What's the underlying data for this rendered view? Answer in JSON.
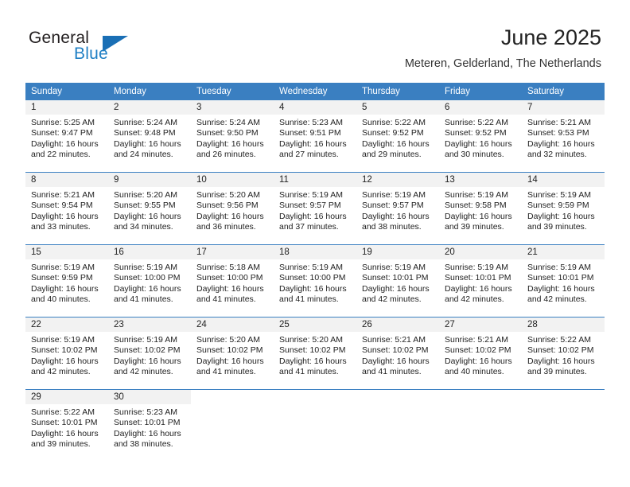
{
  "brand": {
    "name_top": "General",
    "name_bottom": "Blue",
    "accent_color": "#1a6fb5",
    "flag_icon": "flag-triangle-icon"
  },
  "header": {
    "title": "June 2025",
    "subtitle": "Meteren, Gelderland, The Netherlands"
  },
  "theme": {
    "header_bg": "#3a7fc1",
    "daynum_bg": "#f2f2f2",
    "cell_bg": "#ffffff",
    "text": "#222222"
  },
  "calendar": {
    "weekday_headers": [
      "Sunday",
      "Monday",
      "Tuesday",
      "Wednesday",
      "Thursday",
      "Friday",
      "Saturday"
    ],
    "weeks": [
      [
        {
          "day": "1",
          "sunrise": "Sunrise: 5:25 AM",
          "sunset": "Sunset: 9:47 PM",
          "daylight_1": "Daylight: 16 hours",
          "daylight_2": "and 22 minutes."
        },
        {
          "day": "2",
          "sunrise": "Sunrise: 5:24 AM",
          "sunset": "Sunset: 9:48 PM",
          "daylight_1": "Daylight: 16 hours",
          "daylight_2": "and 24 minutes."
        },
        {
          "day": "3",
          "sunrise": "Sunrise: 5:24 AM",
          "sunset": "Sunset: 9:50 PM",
          "daylight_1": "Daylight: 16 hours",
          "daylight_2": "and 26 minutes."
        },
        {
          "day": "4",
          "sunrise": "Sunrise: 5:23 AM",
          "sunset": "Sunset: 9:51 PM",
          "daylight_1": "Daylight: 16 hours",
          "daylight_2": "and 27 minutes."
        },
        {
          "day": "5",
          "sunrise": "Sunrise: 5:22 AM",
          "sunset": "Sunset: 9:52 PM",
          "daylight_1": "Daylight: 16 hours",
          "daylight_2": "and 29 minutes."
        },
        {
          "day": "6",
          "sunrise": "Sunrise: 5:22 AM",
          "sunset": "Sunset: 9:52 PM",
          "daylight_1": "Daylight: 16 hours",
          "daylight_2": "and 30 minutes."
        },
        {
          "day": "7",
          "sunrise": "Sunrise: 5:21 AM",
          "sunset": "Sunset: 9:53 PM",
          "daylight_1": "Daylight: 16 hours",
          "daylight_2": "and 32 minutes."
        }
      ],
      [
        {
          "day": "8",
          "sunrise": "Sunrise: 5:21 AM",
          "sunset": "Sunset: 9:54 PM",
          "daylight_1": "Daylight: 16 hours",
          "daylight_2": "and 33 minutes."
        },
        {
          "day": "9",
          "sunrise": "Sunrise: 5:20 AM",
          "sunset": "Sunset: 9:55 PM",
          "daylight_1": "Daylight: 16 hours",
          "daylight_2": "and 34 minutes."
        },
        {
          "day": "10",
          "sunrise": "Sunrise: 5:20 AM",
          "sunset": "Sunset: 9:56 PM",
          "daylight_1": "Daylight: 16 hours",
          "daylight_2": "and 36 minutes."
        },
        {
          "day": "11",
          "sunrise": "Sunrise: 5:19 AM",
          "sunset": "Sunset: 9:57 PM",
          "daylight_1": "Daylight: 16 hours",
          "daylight_2": "and 37 minutes."
        },
        {
          "day": "12",
          "sunrise": "Sunrise: 5:19 AM",
          "sunset": "Sunset: 9:57 PM",
          "daylight_1": "Daylight: 16 hours",
          "daylight_2": "and 38 minutes."
        },
        {
          "day": "13",
          "sunrise": "Sunrise: 5:19 AM",
          "sunset": "Sunset: 9:58 PM",
          "daylight_1": "Daylight: 16 hours",
          "daylight_2": "and 39 minutes."
        },
        {
          "day": "14",
          "sunrise": "Sunrise: 5:19 AM",
          "sunset": "Sunset: 9:59 PM",
          "daylight_1": "Daylight: 16 hours",
          "daylight_2": "and 39 minutes."
        }
      ],
      [
        {
          "day": "15",
          "sunrise": "Sunrise: 5:19 AM",
          "sunset": "Sunset: 9:59 PM",
          "daylight_1": "Daylight: 16 hours",
          "daylight_2": "and 40 minutes."
        },
        {
          "day": "16",
          "sunrise": "Sunrise: 5:19 AM",
          "sunset": "Sunset: 10:00 PM",
          "daylight_1": "Daylight: 16 hours",
          "daylight_2": "and 41 minutes."
        },
        {
          "day": "17",
          "sunrise": "Sunrise: 5:18 AM",
          "sunset": "Sunset: 10:00 PM",
          "daylight_1": "Daylight: 16 hours",
          "daylight_2": "and 41 minutes."
        },
        {
          "day": "18",
          "sunrise": "Sunrise: 5:19 AM",
          "sunset": "Sunset: 10:00 PM",
          "daylight_1": "Daylight: 16 hours",
          "daylight_2": "and 41 minutes."
        },
        {
          "day": "19",
          "sunrise": "Sunrise: 5:19 AM",
          "sunset": "Sunset: 10:01 PM",
          "daylight_1": "Daylight: 16 hours",
          "daylight_2": "and 42 minutes."
        },
        {
          "day": "20",
          "sunrise": "Sunrise: 5:19 AM",
          "sunset": "Sunset: 10:01 PM",
          "daylight_1": "Daylight: 16 hours",
          "daylight_2": "and 42 minutes."
        },
        {
          "day": "21",
          "sunrise": "Sunrise: 5:19 AM",
          "sunset": "Sunset: 10:01 PM",
          "daylight_1": "Daylight: 16 hours",
          "daylight_2": "and 42 minutes."
        }
      ],
      [
        {
          "day": "22",
          "sunrise": "Sunrise: 5:19 AM",
          "sunset": "Sunset: 10:02 PM",
          "daylight_1": "Daylight: 16 hours",
          "daylight_2": "and 42 minutes."
        },
        {
          "day": "23",
          "sunrise": "Sunrise: 5:19 AM",
          "sunset": "Sunset: 10:02 PM",
          "daylight_1": "Daylight: 16 hours",
          "daylight_2": "and 42 minutes."
        },
        {
          "day": "24",
          "sunrise": "Sunrise: 5:20 AM",
          "sunset": "Sunset: 10:02 PM",
          "daylight_1": "Daylight: 16 hours",
          "daylight_2": "and 41 minutes."
        },
        {
          "day": "25",
          "sunrise": "Sunrise: 5:20 AM",
          "sunset": "Sunset: 10:02 PM",
          "daylight_1": "Daylight: 16 hours",
          "daylight_2": "and 41 minutes."
        },
        {
          "day": "26",
          "sunrise": "Sunrise: 5:21 AM",
          "sunset": "Sunset: 10:02 PM",
          "daylight_1": "Daylight: 16 hours",
          "daylight_2": "and 41 minutes."
        },
        {
          "day": "27",
          "sunrise": "Sunrise: 5:21 AM",
          "sunset": "Sunset: 10:02 PM",
          "daylight_1": "Daylight: 16 hours",
          "daylight_2": "and 40 minutes."
        },
        {
          "day": "28",
          "sunrise": "Sunrise: 5:22 AM",
          "sunset": "Sunset: 10:02 PM",
          "daylight_1": "Daylight: 16 hours",
          "daylight_2": "and 39 minutes."
        }
      ],
      [
        {
          "day": "29",
          "sunrise": "Sunrise: 5:22 AM",
          "sunset": "Sunset: 10:01 PM",
          "daylight_1": "Daylight: 16 hours",
          "daylight_2": "and 39 minutes."
        },
        {
          "day": "30",
          "sunrise": "Sunrise: 5:23 AM",
          "sunset": "Sunset: 10:01 PM",
          "daylight_1": "Daylight: 16 hours",
          "daylight_2": "and 38 minutes."
        },
        {
          "day": "",
          "sunrise": "",
          "sunset": "",
          "daylight_1": "",
          "daylight_2": ""
        },
        {
          "day": "",
          "sunrise": "",
          "sunset": "",
          "daylight_1": "",
          "daylight_2": ""
        },
        {
          "day": "",
          "sunrise": "",
          "sunset": "",
          "daylight_1": "",
          "daylight_2": ""
        },
        {
          "day": "",
          "sunrise": "",
          "sunset": "",
          "daylight_1": "",
          "daylight_2": ""
        },
        {
          "day": "",
          "sunrise": "",
          "sunset": "",
          "daylight_1": "",
          "daylight_2": ""
        }
      ]
    ]
  }
}
